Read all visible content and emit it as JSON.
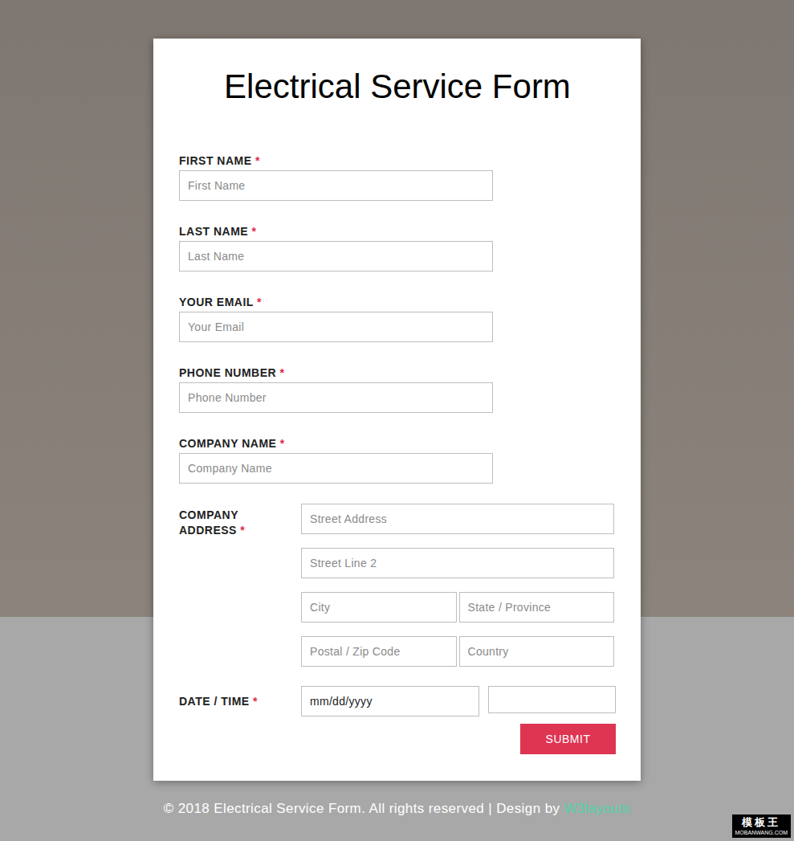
{
  "title": "Electrical Service Form",
  "fields": [
    {
      "label": "FIRST NAME",
      "required_mark": "*",
      "placeholder": "First Name"
    },
    {
      "label": "LAST NAME",
      "required_mark": "*",
      "placeholder": "Last Name"
    },
    {
      "label": "YOUR EMAIL",
      "required_mark": "*",
      "placeholder": "Your Email"
    },
    {
      "label": "PHONE NUMBER",
      "required_mark": "*",
      "placeholder": "Phone Number"
    },
    {
      "label": "COMPANY NAME",
      "required_mark": "*",
      "placeholder": "Company Name"
    }
  ],
  "address": {
    "label": "COMPANY ADDRESS",
    "required_mark": "*",
    "rows": [
      [
        "Street Address"
      ],
      [
        "Street Line 2"
      ],
      [
        "City",
        "State / Province"
      ],
      [
        "Postal / Zip Code",
        "Country"
      ]
    ]
  },
  "datetime": {
    "label": "DATE / TIME",
    "required_mark": "*",
    "date_placeholder": "mm/dd/yyyy"
  },
  "submit": "SUBMIT",
  "footer": {
    "text": "© 2018 Electrical Service Form. All rights reserved | Design by",
    "link": "W3layouts"
  },
  "watermark": {
    "name": "模板王",
    "site": "MOBANWANG.COM"
  }
}
